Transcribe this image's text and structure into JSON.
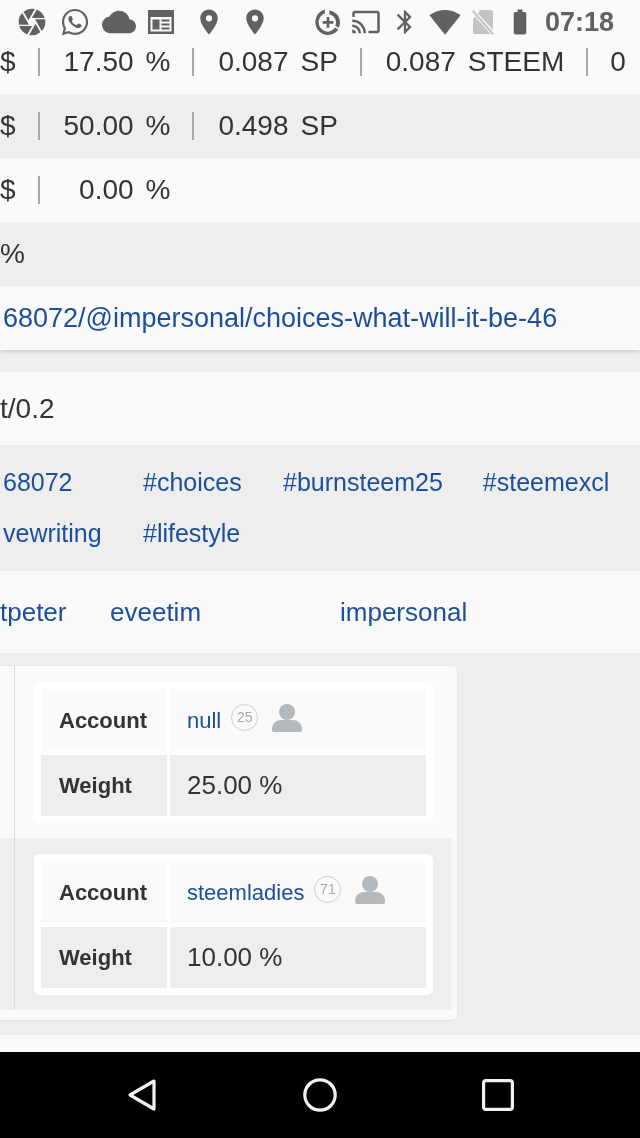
{
  "status_bar": {
    "time": "07:18"
  },
  "payout_table": {
    "rows": [
      {
        "kind": "amounts",
        "cells": [
          {
            "value": "$"
          },
          {
            "value": "17.50",
            "unit": "%"
          },
          {
            "value": "0.087",
            "unit": "SP"
          },
          {
            "value": "0.087",
            "unit": "STEEM"
          },
          {
            "value": "0"
          }
        ]
      },
      {
        "kind": "amounts",
        "cells": [
          {
            "value": "$"
          },
          {
            "value": "50.00",
            "unit": "%"
          },
          {
            "value": "0.498",
            "unit": "SP"
          }
        ]
      },
      {
        "kind": "amounts",
        "cells": [
          {
            "value": "$"
          },
          {
            "value": "0.00",
            "unit": "%"
          }
        ]
      },
      {
        "kind": "text",
        "text": "%"
      },
      {
        "kind": "link",
        "text": "68072/@impersonal/choices-what-will-it-be-46"
      }
    ]
  },
  "details_table": {
    "rows": [
      {
        "kind": "text",
        "text": "t/0.2"
      },
      {
        "kind": "tags",
        "tags": [
          "68072",
          "#choices",
          "#burnsteem25",
          "#steemexcl",
          "vewriting",
          "#lifestyle"
        ]
      },
      {
        "kind": "links",
        "links": [
          "tpeter",
          "eveetim",
          "impersonal"
        ]
      },
      {
        "kind": "beneficiaries",
        "beneficiaries": [
          {
            "account_label": "Account",
            "account": "null",
            "reputation": "25",
            "weight_label": "Weight",
            "weight": "25.00 %"
          },
          {
            "account_label": "Account",
            "account": "steemladies",
            "reputation": "71",
            "weight_label": "Weight",
            "weight": "10.00 %"
          }
        ]
      }
    ]
  }
}
